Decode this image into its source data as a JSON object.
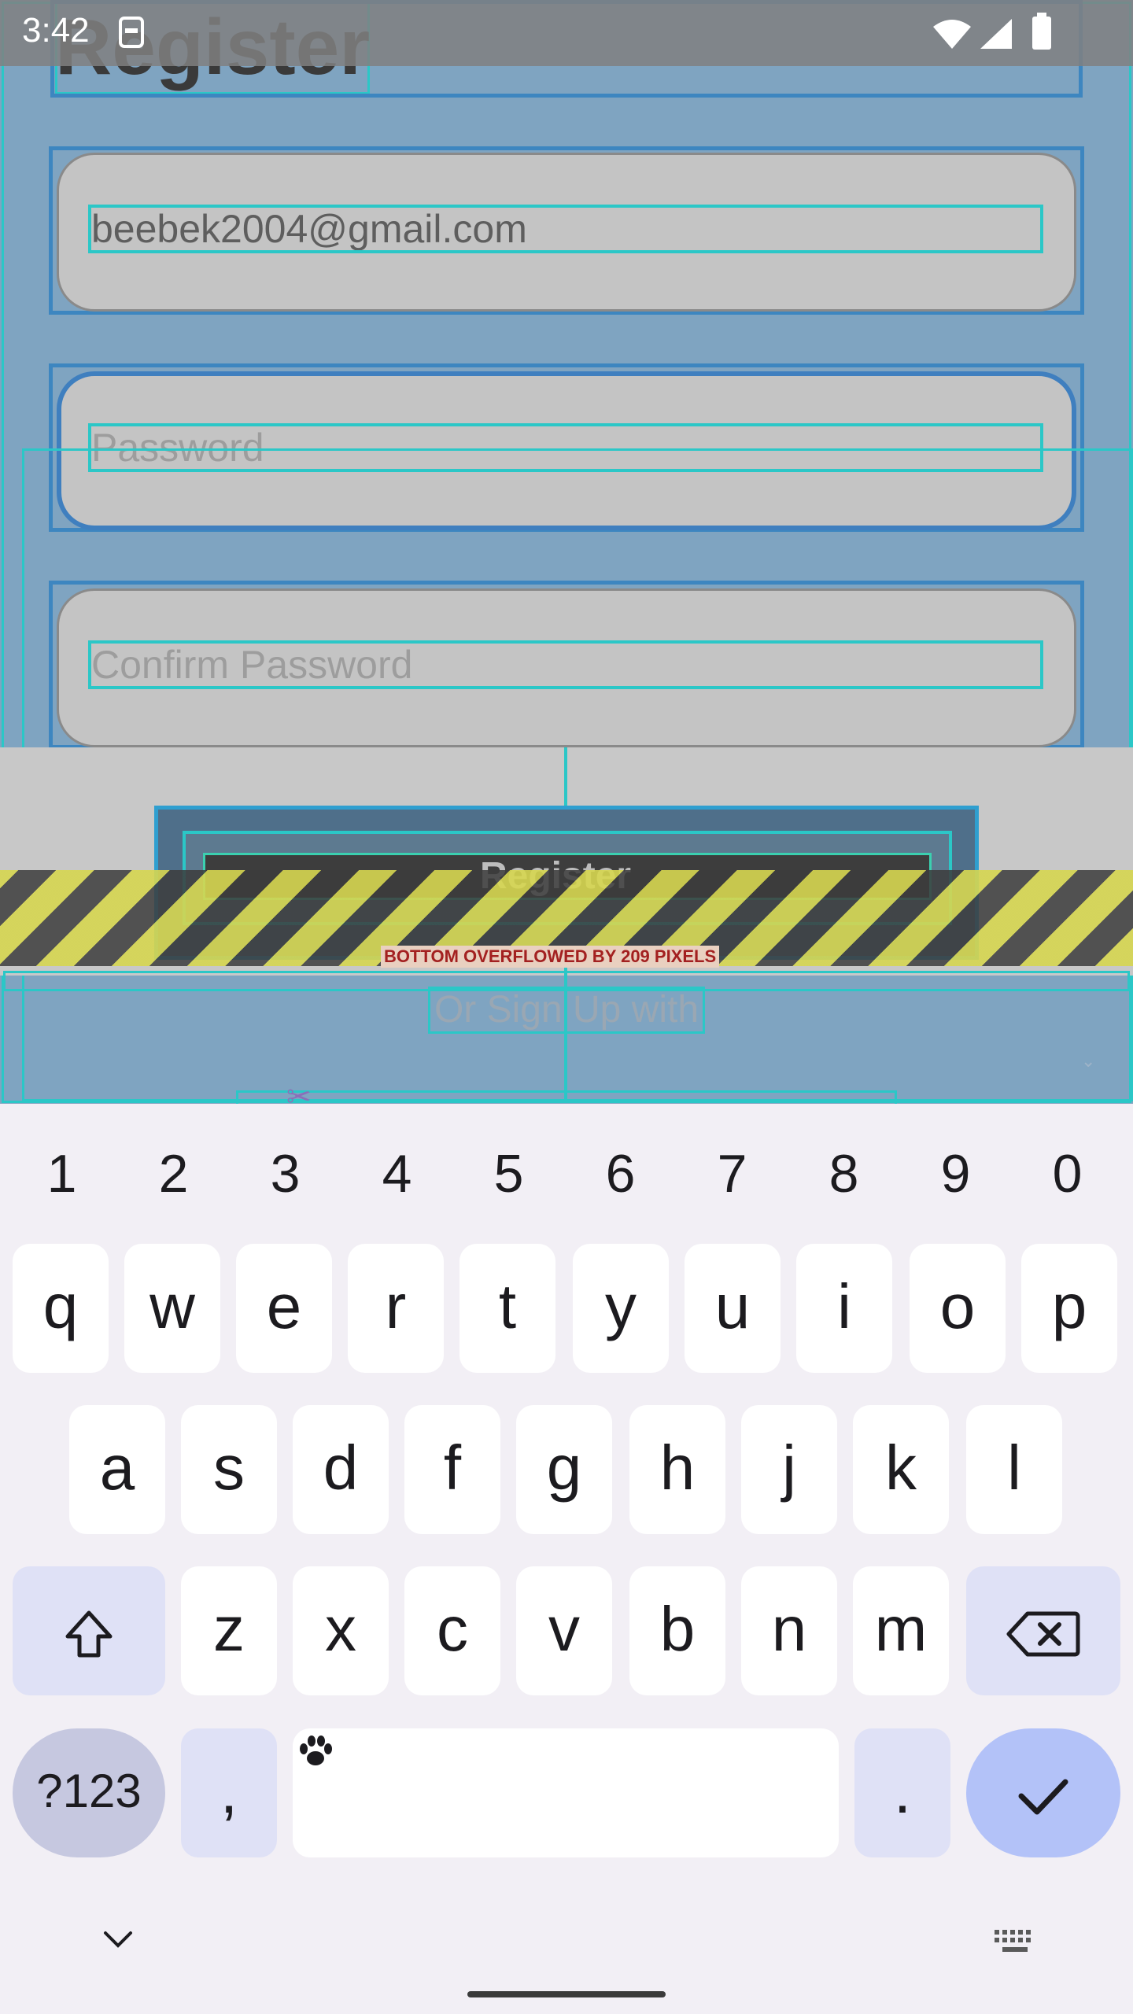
{
  "status_bar": {
    "time": "3:42",
    "icons": [
      "sim-card-icon",
      "wifi-icon",
      "signal-icon",
      "battery-icon"
    ]
  },
  "page": {
    "title": "Register"
  },
  "form": {
    "email": {
      "value": "beebek2004@gmail.com"
    },
    "password": {
      "placeholder": "Password"
    },
    "confirm_password": {
      "placeholder": "Confirm Password"
    },
    "register_button": "Register",
    "or_signup_label": "Or Sign Up with"
  },
  "debug": {
    "overflow_message": "BOTTOM OVERFLOWED BY 209 PIXELS"
  },
  "keyboard": {
    "number_row": [
      "1",
      "2",
      "3",
      "4",
      "5",
      "6",
      "7",
      "8",
      "9",
      "0"
    ],
    "row1": [
      "q",
      "w",
      "e",
      "r",
      "t",
      "y",
      "u",
      "i",
      "o",
      "p"
    ],
    "row2": [
      "a",
      "s",
      "d",
      "f",
      "g",
      "h",
      "j",
      "k",
      "l"
    ],
    "row3": [
      "z",
      "x",
      "c",
      "v",
      "b",
      "n",
      "m"
    ],
    "symbols_key": "?123",
    "comma_key": ",",
    "period_key": "."
  },
  "colors": {
    "overlay_debug": "#2bc7c7",
    "app_bg": "#7fa4c1",
    "keyboard_bg": "#f2eff5",
    "done_key": "#b3c2f8"
  }
}
